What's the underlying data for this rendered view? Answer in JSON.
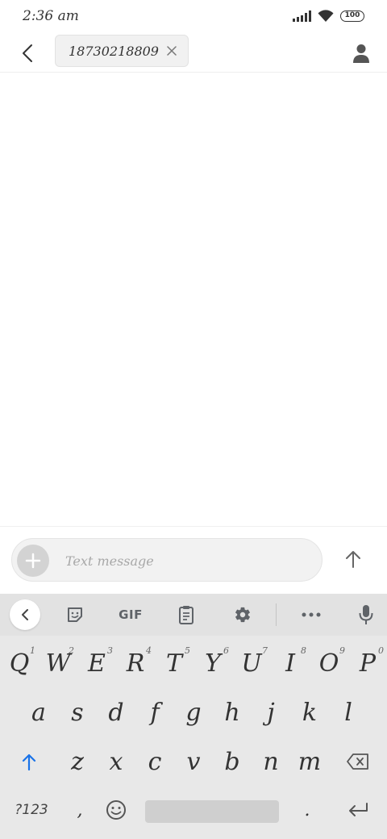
{
  "status_bar": {
    "time": "2:36 am",
    "battery": "100"
  },
  "header": {
    "recipient": "18730218809"
  },
  "compose": {
    "placeholder": "Text message"
  },
  "keyboard": {
    "toolbar": {
      "gif_label": "GIF"
    },
    "row1": [
      {
        "label": "Q",
        "hint": "1"
      },
      {
        "label": "W",
        "hint": "2"
      },
      {
        "label": "E",
        "hint": "3"
      },
      {
        "label": "R",
        "hint": "4"
      },
      {
        "label": "T",
        "hint": "5"
      },
      {
        "label": "Y",
        "hint": "6"
      },
      {
        "label": "U",
        "hint": "7"
      },
      {
        "label": "I",
        "hint": "8"
      },
      {
        "label": "O",
        "hint": "9"
      },
      {
        "label": "P",
        "hint": "0"
      }
    ],
    "row2": [
      "a",
      "s",
      "d",
      "f",
      "g",
      "h",
      "j",
      "k",
      "l"
    ],
    "row3": [
      "z",
      "x",
      "c",
      "v",
      "b",
      "n",
      "m"
    ],
    "row4": {
      "symbols_label": "?123",
      "comma": ",",
      "period": "."
    }
  },
  "colors": {
    "accent": "#1a73e8",
    "icon": "#5f6368"
  }
}
